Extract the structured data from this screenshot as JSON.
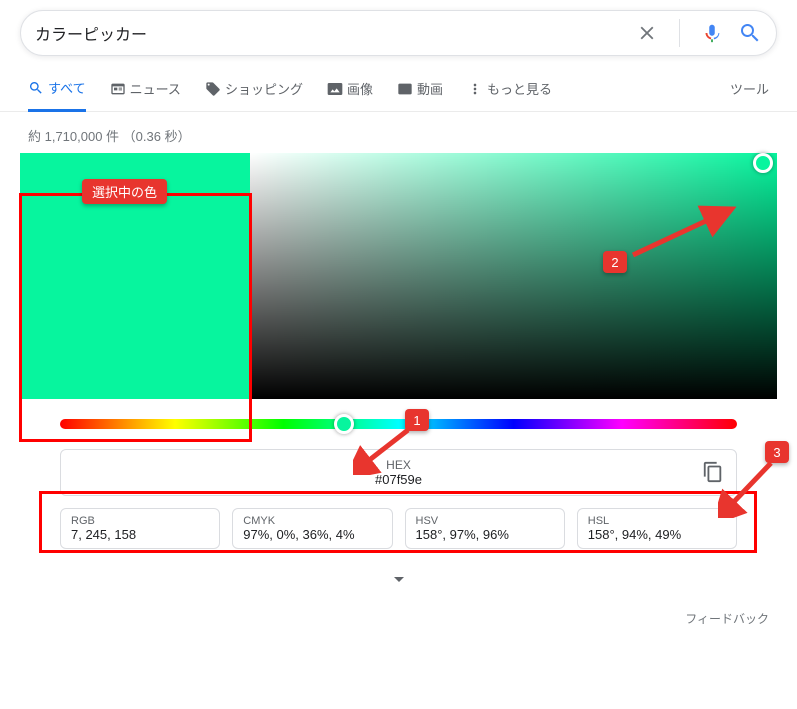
{
  "search": {
    "query": "カラーピッカー"
  },
  "tabs": {
    "all": "すべて",
    "news": "ニュース",
    "shopping": "ショッピング",
    "images": "画像",
    "videos": "動画",
    "more": "もっと見る",
    "tools": "ツール"
  },
  "stats": "約 1,710,000 件 （0.36 秒）",
  "picker": {
    "selected_color": "#07f59e",
    "hex_label": "HEX",
    "hex_value": "#07f59e",
    "formats": {
      "rgb": {
        "label": "RGB",
        "value": "7, 245, 158"
      },
      "cmyk": {
        "label": "CMYK",
        "value": "97%, 0%, 36%, 4%"
      },
      "hsv": {
        "label": "HSV",
        "value": "158°, 97%, 96%"
      },
      "hsl": {
        "label": "HSL",
        "value": "158°, 94%, 49%"
      }
    }
  },
  "feedback": "フィードバック",
  "annotations": {
    "selected_label": "選択中の色",
    "n1": "1",
    "n2": "2",
    "n3": "3"
  }
}
